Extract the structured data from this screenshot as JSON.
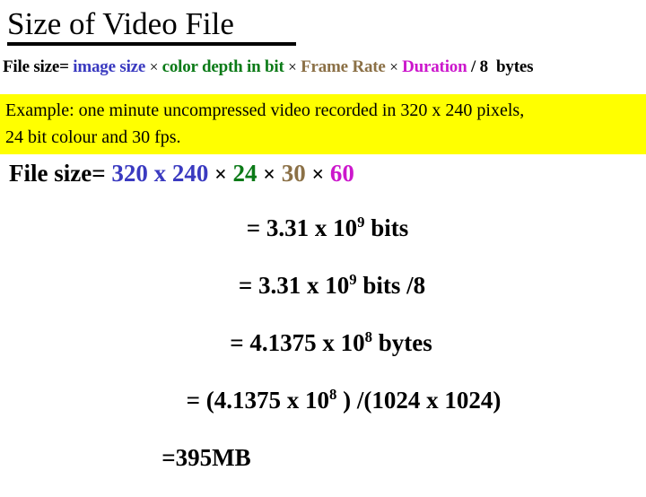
{
  "slide": {
    "title": "Size of Video File",
    "background_color": "#ffffff",
    "text_color": "#000000"
  },
  "formula": {
    "prefix": "File size=",
    "term_image_size": "image size",
    "op1": "×",
    "term_color_depth": "color depth in bit",
    "op2": "×",
    "term_frame_rate": "Frame Rate",
    "op3": "×",
    "term_duration": "Duration",
    "divider": "/ 8",
    "unit": "bytes",
    "colors": {
      "image_size": "#3a3ac0",
      "color_depth": "#0b7a17",
      "frame_rate": "#8b7046",
      "duration": "#cc17cc",
      "plain": "#000000"
    }
  },
  "example": {
    "highlight_color": "#ffff00",
    "line1": "Example: one minute uncompressed video recorded in 320 x 240 pixels,",
    "line2": "24 bit colour and 30 fps."
  },
  "computation": {
    "prefix": "File size=",
    "value_image_size": "320 x 240",
    "op1": "×",
    "value_color_depth": "24",
    "op2": "×",
    "value_frame_rate": "30",
    "op3": "×",
    "value_duration": "60"
  },
  "results": [
    {
      "text_before": "= 3.31 x 10",
      "exponent": "9",
      "text_after": " bits"
    },
    {
      "text_before": "= 3.31 x 10",
      "exponent": "9",
      "text_after": " bits /8"
    },
    {
      "text_before": "= 4.1375 x 10",
      "exponent": "8",
      "text_after": " bytes"
    },
    {
      "text_before": "= (4.1375 x 10",
      "exponent": "8",
      "text_after": " ) /(1024 x 1024)"
    },
    {
      "text_before": "=395MB",
      "exponent": "",
      "text_after": ""
    }
  ]
}
